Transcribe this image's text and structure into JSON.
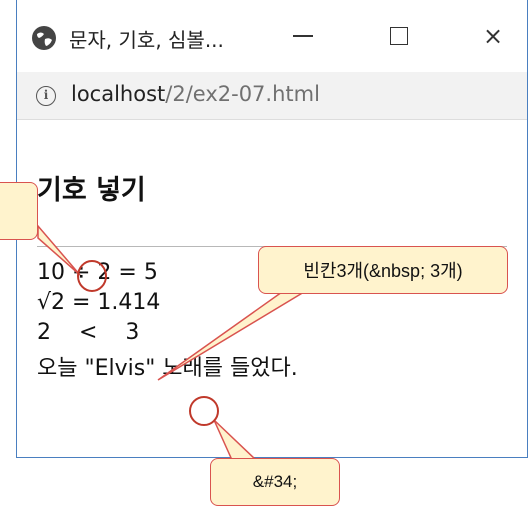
{
  "window": {
    "title": "문자, 기호, 심볼...",
    "controls": {
      "minimize": "minimize",
      "maximize": "maximize",
      "close": "×"
    }
  },
  "address": {
    "host": "localhost",
    "path": "/2/ex2-07.html"
  },
  "page": {
    "heading": "기호 넣기",
    "lines": [
      "10 ÷ 2 = 5",
      "√2 = 1.414",
      "2    <    3",
      "오늘 \"Elvis\" 노래를 들었다."
    ]
  },
  "annotations": {
    "left": "",
    "right": "빈칸3개(&nbsp; 3개)",
    "bottom": "&#34;"
  },
  "colors": {
    "callout_fill": "#fff3cd",
    "callout_border": "#d9534f",
    "window_border": "#4a7fc0"
  }
}
